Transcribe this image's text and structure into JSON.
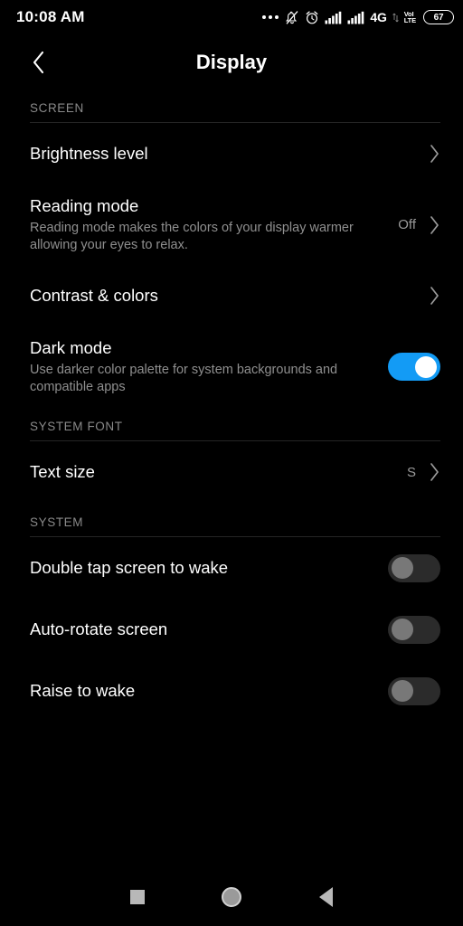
{
  "status_bar": {
    "time": "10:08 AM",
    "icons": [
      {
        "name": "more-dots-icon"
      },
      {
        "name": "notifications-muted-icon"
      },
      {
        "name": "alarm-icon"
      },
      {
        "name": "signal-bars-sim1-icon"
      },
      {
        "name": "signal-bars-sim2-icon"
      }
    ],
    "network_label": "4G",
    "volte_line1": "VoI",
    "volte_line2": "LTE",
    "battery_percent": "67"
  },
  "app_bar": {
    "back_icon": "back-chevron-icon",
    "title": "Display"
  },
  "sections": [
    {
      "header": "SCREEN",
      "rows": [
        {
          "name": "brightness-level",
          "title": "Brightness level",
          "desc": "",
          "value": "",
          "control": "chevron"
        },
        {
          "name": "reading-mode",
          "title": "Reading mode",
          "desc": "Reading mode makes the colors of your display warmer allowing your eyes to relax.",
          "value": "Off",
          "control": "chevron"
        },
        {
          "name": "contrast-and-colors",
          "title": "Contrast & colors",
          "desc": "",
          "value": "",
          "control": "chevron"
        },
        {
          "name": "dark-mode",
          "title": "Dark mode",
          "desc": "Use darker color palette for system backgrounds and compatible apps",
          "value": "",
          "control": "toggle-on"
        }
      ]
    },
    {
      "header": "SYSTEM FONT",
      "rows": [
        {
          "name": "text-size",
          "title": "Text size",
          "desc": "",
          "value": "S",
          "control": "chevron"
        }
      ]
    },
    {
      "header": "SYSTEM",
      "rows": [
        {
          "name": "double-tap-screen-to-wake",
          "title": "Double tap screen to wake",
          "desc": "",
          "value": "",
          "control": "toggle-off"
        },
        {
          "name": "auto-rotate-screen",
          "title": "Auto-rotate screen",
          "desc": "",
          "value": "",
          "control": "toggle-off"
        },
        {
          "name": "raise-to-wake",
          "title": "Raise to wake",
          "desc": "",
          "value": "",
          "control": "toggle-off"
        }
      ]
    }
  ],
  "nav_bar": {
    "recents_icon": "square-recents-icon",
    "home_icon": "circle-home-icon",
    "back_icon": "triangle-back-icon"
  },
  "colors": {
    "background": "#000000",
    "toggle_on": "#139bf5",
    "toggle_off_track": "#2b2b2b",
    "toggle_off_thumb": "#787878",
    "primary_text": "#ffffff",
    "secondary_text": "#8f8f8f",
    "divider": "#252525"
  }
}
